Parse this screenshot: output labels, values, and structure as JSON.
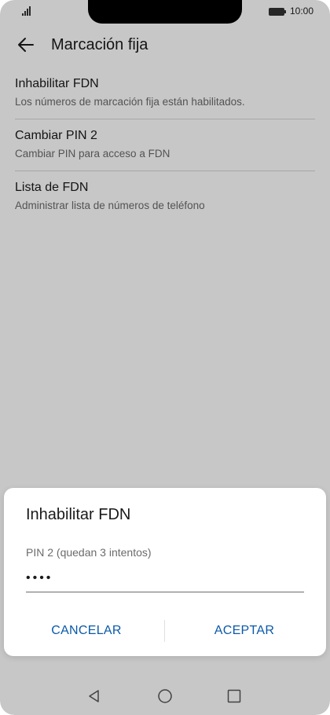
{
  "status_bar": {
    "time": "10:00",
    "icons": [
      "signal-icon",
      "battery-icon"
    ]
  },
  "header": {
    "title": "Marcación fija",
    "back_icon": "arrow-left-icon"
  },
  "list": {
    "items": [
      {
        "title": "Inhabilitar FDN",
        "subtitle": "Los números de marcación fija están habilitados."
      },
      {
        "title": "Cambiar PIN 2",
        "subtitle": "Cambiar PIN para acceso a FDN"
      },
      {
        "title": "Lista de FDN",
        "subtitle": "Administrar lista de números de teléfono"
      }
    ]
  },
  "dialog": {
    "title": "Inhabilitar FDN",
    "field_label": "PIN 2 (quedan 3 intentos)",
    "field_value": "••••",
    "cancel_label": "CANCELAR",
    "ok_label": "ACEPTAR"
  },
  "colors": {
    "accent": "#0a59a8",
    "scrim": "#000000"
  },
  "nav_bar": {
    "icons": [
      "back-triangle-icon",
      "home-circle-icon",
      "recent-square-icon"
    ]
  }
}
